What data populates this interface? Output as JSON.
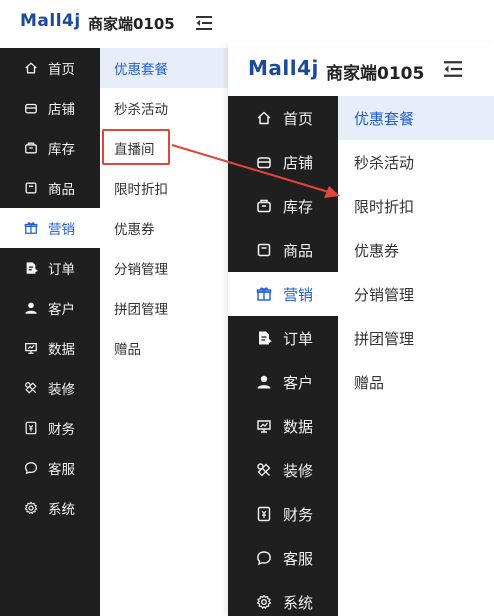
{
  "app": {
    "logo_text": "Mall4j",
    "shop_name": "商家端0105"
  },
  "sidebar": {
    "items": [
      {
        "label": "首页",
        "icon": "home-icon"
      },
      {
        "label": "店铺",
        "icon": "store-icon"
      },
      {
        "label": "库存",
        "icon": "inventory-icon"
      },
      {
        "label": "商品",
        "icon": "product-icon"
      },
      {
        "label": "营销",
        "icon": "gift-icon",
        "active": true
      },
      {
        "label": "订单",
        "icon": "order-icon"
      },
      {
        "label": "客户",
        "icon": "user-icon"
      },
      {
        "label": "数据",
        "icon": "chart-icon"
      },
      {
        "label": "装修",
        "icon": "decoration-icon"
      },
      {
        "label": "财务",
        "icon": "finance-icon"
      },
      {
        "label": "客服",
        "icon": "chat-icon"
      },
      {
        "label": "系统",
        "icon": "settings-icon"
      }
    ]
  },
  "submenu_before": {
    "items": [
      "优惠套餐",
      "秒杀活动",
      "直播间",
      "限时折扣",
      "优惠券",
      "分销管理",
      "拼团管理",
      "赠品"
    ],
    "active_index": 0,
    "highlighted_index": 2
  },
  "submenu_after": {
    "items": [
      "优惠套餐",
      "秒杀活动",
      "限时折扣",
      "优惠券",
      "分销管理",
      "拼团管理",
      "赠品"
    ],
    "active_index": 0
  },
  "colors": {
    "sidebar_bg": "#1f1f1f",
    "accent": "#1e5fd6",
    "logo": "#1c4a9b",
    "highlight": "#e2453c",
    "active_sub_bg": "#e8eef9"
  }
}
